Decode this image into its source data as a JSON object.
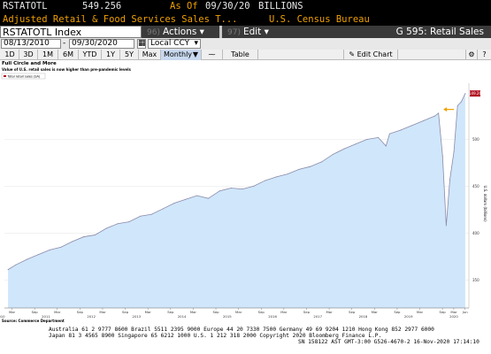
{
  "header": {
    "ticker": "RSTATOTL",
    "value": "549.256",
    "as_of_label": "As Of",
    "as_of_date": "09/30/20",
    "units": "BILLIONS",
    "description": "Adjusted Retail & Food Services Sales T...",
    "source": "U.S. Census Bureau"
  },
  "toolbar": {
    "security": "RSTATOTL Index",
    "actions_num": "96)",
    "actions_label": "Actions",
    "edit_num": "97)",
    "edit_label": "Edit",
    "page_title": "G 595: Retail Sales"
  },
  "dates": {
    "start": "08/13/2010",
    "end": "09/30/2020",
    "currency": "Local CCY"
  },
  "ranges": [
    "1D",
    "3D",
    "1M",
    "6M",
    "YTD",
    "1Y",
    "5Y",
    "Max"
  ],
  "frequency": "Monthly",
  "table_label": "Table",
  "edit_chart_label": "Edit Chart",
  "colors": {
    "accent": "#f0a000",
    "area": "#cfe6fb",
    "line": "#8a8aa8",
    "last_tag": "#b01020"
  },
  "chart_data": {
    "type": "area",
    "title": "Full Circle and More",
    "subtitle": "Value of U.S. retail sales is now higher than pre-pandemic levels",
    "legend": "Total retail sales (SA)",
    "ylabel": "U.S. dollars (billions)",
    "source": "Source: Commerce Department",
    "last_value_tag": "549.26",
    "ylim": [
      320,
      560
    ],
    "y_ticks": [
      350,
      400,
      450,
      500
    ],
    "year_labels": [
      "2010",
      "2011",
      "2012",
      "2013",
      "2014",
      "2015",
      "2016",
      "2017",
      "2018",
      "2019",
      "2020"
    ],
    "month_ticks": [
      "Mar",
      "Sep",
      "Mar",
      "Sep",
      "Mar",
      "Sep",
      "Mar",
      "Sep",
      "Mar",
      "Sep",
      "Mar",
      "Sep",
      "Mar",
      "Sep",
      "Mar",
      "Sep",
      "Mar",
      "Sep",
      "Mar",
      "Sep",
      "Mar",
      "Jun",
      "Sep"
    ],
    "x": [
      2010.58,
      2010.75,
      2011.0,
      2011.25,
      2011.5,
      2011.75,
      2012.0,
      2012.25,
      2012.5,
      2012.75,
      2013.0,
      2013.25,
      2013.5,
      2013.75,
      2014.0,
      2014.25,
      2014.5,
      2014.75,
      2015.0,
      2015.25,
      2015.5,
      2015.75,
      2016.0,
      2016.25,
      2016.5,
      2016.75,
      2017.0,
      2017.25,
      2017.5,
      2017.75,
      2018.0,
      2018.25,
      2018.5,
      2018.75,
      2018.92,
      2019.0,
      2019.25,
      2019.5,
      2019.75,
      2020.0,
      2020.08,
      2020.17,
      2020.25,
      2020.33,
      2020.42,
      2020.5,
      2020.58,
      2020.67
    ],
    "values": [
      361,
      366,
      372,
      377,
      382,
      385,
      391,
      396,
      398,
      405,
      410,
      412,
      418,
      420,
      426,
      432,
      436,
      440,
      437,
      445,
      448,
      447,
      450,
      456,
      460,
      463,
      468,
      471,
      476,
      484,
      490,
      495,
      500,
      502,
      493,
      506,
      510,
      515,
      520,
      525,
      528,
      482,
      408,
      457,
      487,
      536,
      540,
      549
    ]
  },
  "footer": {
    "line1": "Australia 61 2 9777 8600  Brazil 5511 2395 9000  Europe 44 20 7330 7500  Germany 49 69 9204 1210  Hong Kong 852 2977 6000",
    "line2": "Japan 81 3 4565 8900        Singapore 65 6212 1000        U.S. 1 212 318 2000        Copyright 2020 Bloomberg Finance L.P.",
    "line3": "SN 158122 AST  GMT-3:00 G526-4670-2 16-Nov-2020 17:14:10"
  }
}
